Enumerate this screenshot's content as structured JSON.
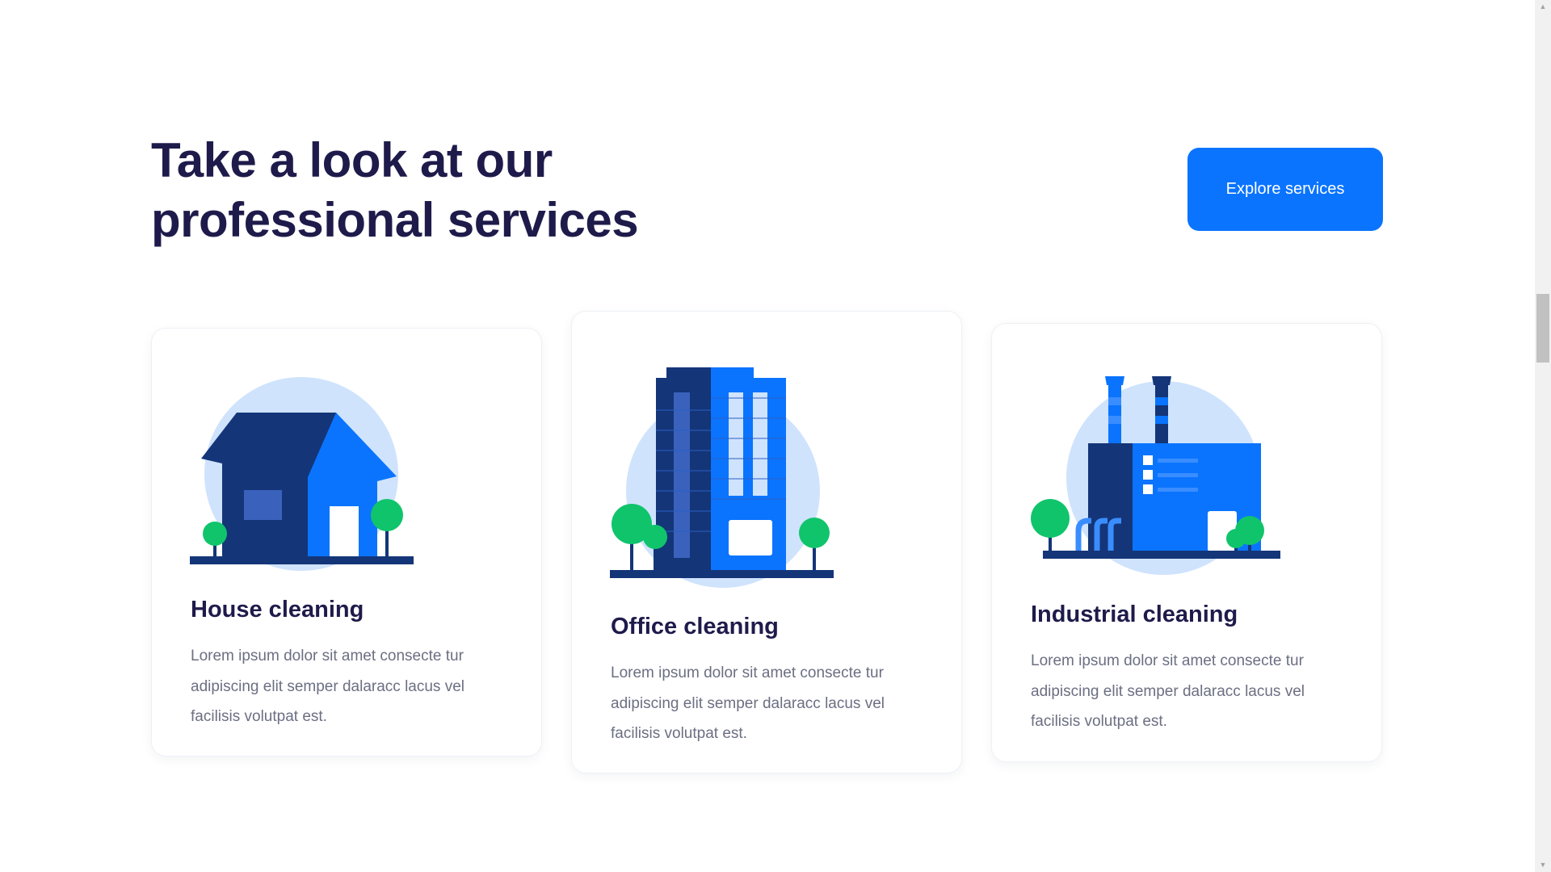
{
  "section": {
    "title": "Take a look at our professional services",
    "explore_button": "Explore services"
  },
  "cards": [
    {
      "icon": "house-icon",
      "title": "House cleaning",
      "description": "Lorem ipsum dolor sit amet consecte tur adipiscing elit semper dalaracc lacus vel facilisis volutpat est."
    },
    {
      "icon": "office-building-icon",
      "title": "Office cleaning",
      "description": "Lorem ipsum dolor sit amet consecte tur adipiscing elit semper dalaracc lacus vel facilisis volutpat est."
    },
    {
      "icon": "factory-icon",
      "title": "Industrial cleaning",
      "description": "Lorem ipsum dolor sit amet consecte tur adipiscing elit semper dalaracc lacus vel facilisis volutpat est."
    }
  ],
  "colors": {
    "accent": "#0a74ff",
    "heading": "#1e1b4b",
    "body_text": "#6b6f82",
    "illustration_dark": "#143578",
    "illustration_light_circle": "#cfe3fd",
    "tree_green": "#10c46b"
  }
}
